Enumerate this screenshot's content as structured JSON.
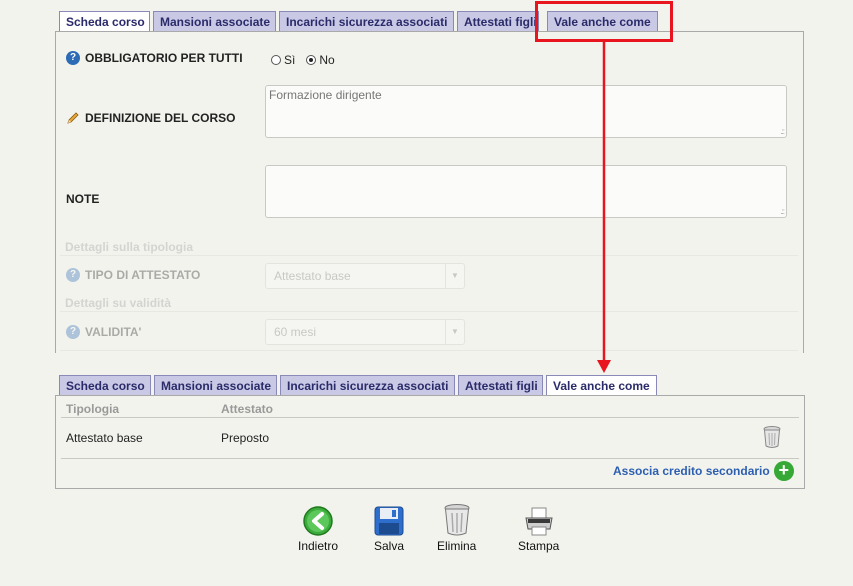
{
  "top_tabs": [
    {
      "label": "Scheda corso",
      "active": true
    },
    {
      "label": "Mansioni associate",
      "active": false
    },
    {
      "label": "Incarichi sicurezza associati",
      "active": false
    },
    {
      "label": "Attestati figli",
      "active": false
    },
    {
      "label": "Vale anche come",
      "active": false
    }
  ],
  "form": {
    "mandatory_label": "OBBLIGATORIO PER TUTTI",
    "radio_yes": "Sì",
    "radio_no": "No",
    "selected": "No",
    "definition_label": "DEFINIZIONE DEL CORSO",
    "definition_value": "Formazione dirigente",
    "notes_label": "NOTE",
    "notes_value": "",
    "type_section": "Dettagli sulla tipologia",
    "type_label": "TIPO DI ATTESTATO",
    "type_value": "Attestato base",
    "validity_section": "Dettagli su validità",
    "validity_label": "VALIDITA'",
    "validity_value": "60 mesi"
  },
  "bottom_tabs": [
    {
      "label": "Scheda corso",
      "active": false
    },
    {
      "label": "Mansioni associate",
      "active": false
    },
    {
      "label": "Incarichi sicurezza associati",
      "active": false
    },
    {
      "label": "Attestati figli",
      "active": false
    },
    {
      "label": "Vale anche come",
      "active": true
    }
  ],
  "table": {
    "columns": [
      "Tipologia",
      "Attestato"
    ],
    "rows": [
      {
        "tipologia": "Attestato base",
        "attestato": "Preposto"
      }
    ],
    "add_link": "Associa credito secondario"
  },
  "actions": {
    "back": "Indietro",
    "save": "Salva",
    "delete": "Elimina",
    "print": "Stampa"
  },
  "colors": {
    "highlight": "#e8141e",
    "add_green": "#35a835",
    "link_blue": "#2d5fb0"
  }
}
